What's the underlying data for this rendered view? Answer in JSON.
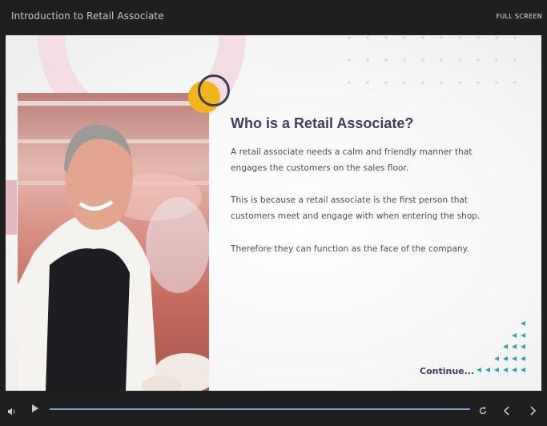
{
  "header": {
    "course_title": "Introduction to Retail Associate",
    "fullscreen_label": "FULL SCREEN"
  },
  "slide": {
    "heading": "Who is a Retail Associate?",
    "paragraphs": [
      "A retail associate needs a calm and friendly manner that engages the customers on the sales floor.",
      "This is because a retail associate is the first person that customers meet and engage with when entering the shop.",
      "Therefore they can function as the face of the company."
    ],
    "continue_label": "Continue...",
    "photo_icon": "smiling-shop-assistant-photo"
  },
  "player": {
    "progress": 1.0,
    "icons": [
      "volume-icon",
      "play-icon",
      "replay-icon",
      "chevron-left-icon",
      "chevron-right-icon"
    ]
  },
  "colors": {
    "accent_navy": "#3c4058",
    "accent_gold": "#f2b51d",
    "accent_teal": "#2aa7a6",
    "accent_pink": "#f3dde2",
    "progress_blue": "#4a6b9c"
  }
}
